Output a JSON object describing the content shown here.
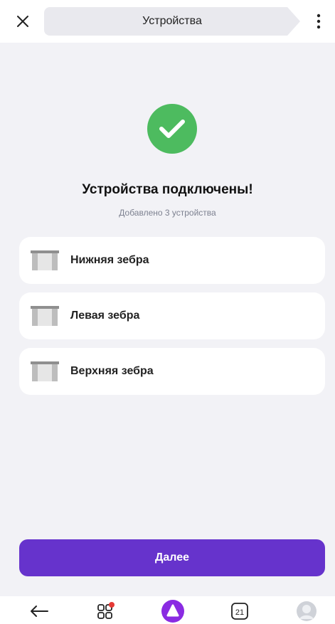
{
  "header": {
    "title": "Устройства",
    "close_icon": "close-icon",
    "more_icon": "more-vertical-icon"
  },
  "status": {
    "icon": "checkmark-icon",
    "icon_color": "#4dbb5f",
    "heading": "Устройства подключены!",
    "subheading": "Добавлено 3 устройства"
  },
  "devices": [
    {
      "label": "Нижняя зебра",
      "icon": "curtain-icon"
    },
    {
      "label": "Левая зебра",
      "icon": "curtain-icon"
    },
    {
      "label": "Верхняя зебра",
      "icon": "curtain-icon"
    }
  ],
  "next_button": {
    "label": "Далее",
    "color": "#6633cc"
  },
  "navbar": {
    "back_icon": "back-arrow-icon",
    "services_icon": "services-grid-icon",
    "services_badge_color": "#e53935",
    "alice_icon": "alice-icon",
    "calendar_icon": "calendar-icon",
    "calendar_day": "21",
    "profile_icon": "profile-icon"
  }
}
